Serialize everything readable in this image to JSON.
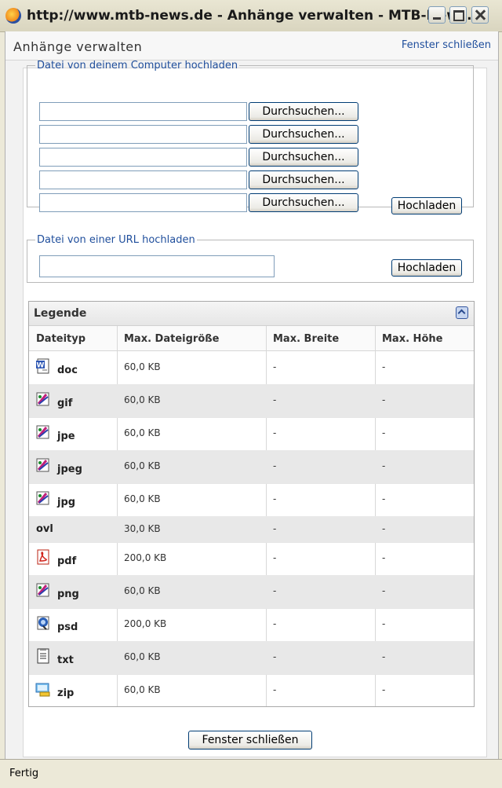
{
  "window": {
    "title": "http://www.mtb-news.de - Anhänge verwalten - MTB-News...."
  },
  "page": {
    "title": "Anhänge verwalten",
    "close_link": "Fenster schließen"
  },
  "computer_upload": {
    "legend": "Datei von deinem Computer hochladen",
    "browse_label": "Durchsuchen...",
    "upload_label": "Hochladen"
  },
  "url_upload": {
    "legend": "Datei von einer URL hochladen",
    "value": "",
    "upload_label": "Hochladen"
  },
  "legend_table": {
    "title": "Legende",
    "headers": [
      "Dateityp",
      "Max. Dateigröße",
      "Max. Breite",
      "Max. Höhe"
    ],
    "rows": [
      {
        "ext": "doc",
        "size": "60,0 KB",
        "width": "-",
        "height": "-",
        "icon": "word-document-icon"
      },
      {
        "ext": "gif",
        "size": "60,0 KB",
        "width": "-",
        "height": "-",
        "icon": "image-file-icon"
      },
      {
        "ext": "jpe",
        "size": "60,0 KB",
        "width": "-",
        "height": "-",
        "icon": "image-file-icon"
      },
      {
        "ext": "jpeg",
        "size": "60,0 KB",
        "width": "-",
        "height": "-",
        "icon": "image-file-icon"
      },
      {
        "ext": "jpg",
        "size": "60,0 KB",
        "width": "-",
        "height": "-",
        "icon": "image-file-icon"
      },
      {
        "ext": "ovl",
        "size": "30,0 KB",
        "width": "-",
        "height": "-",
        "icon": ""
      },
      {
        "ext": "pdf",
        "size": "200,0 KB",
        "width": "-",
        "height": "-",
        "icon": "pdf-file-icon"
      },
      {
        "ext": "png",
        "size": "60,0 KB",
        "width": "-",
        "height": "-",
        "icon": "image-file-icon"
      },
      {
        "ext": "psd",
        "size": "200,0 KB",
        "width": "-",
        "height": "-",
        "icon": "photoshop-file-icon"
      },
      {
        "ext": "txt",
        "size": "60,0 KB",
        "width": "-",
        "height": "-",
        "icon": "text-file-icon"
      },
      {
        "ext": "zip",
        "size": "60,0 KB",
        "width": "-",
        "height": "-",
        "icon": "zip-archive-icon"
      }
    ]
  },
  "footer": {
    "close_button": "Fenster schließen"
  },
  "status": {
    "text": "Fertig"
  }
}
